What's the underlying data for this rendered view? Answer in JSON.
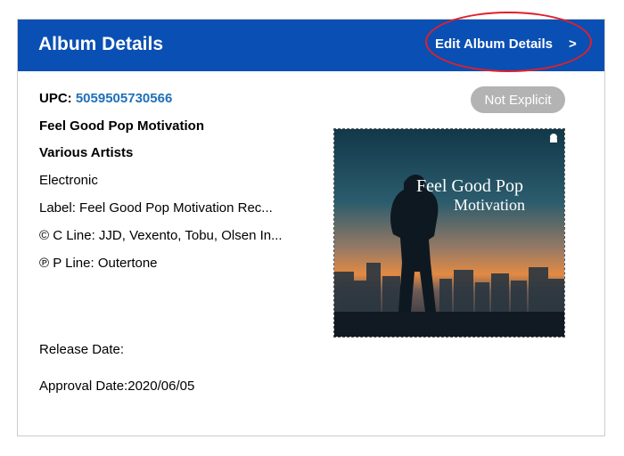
{
  "header": {
    "title": "Album Details",
    "edit_label": "Edit Album Details",
    "edit_chevron": ">"
  },
  "album": {
    "upc_label": "UPC:",
    "upc_value": "5059505730566",
    "title": "Feel Good Pop Motivation",
    "artist": "Various Artists",
    "genre": "Electronic",
    "label_line": "Label: Feel Good Pop Motivation Rec...",
    "c_line": "© C Line: JJD, Vexento, Tobu, Olsen In...",
    "p_line": "℗ P Line: Outertone",
    "release_date": "Release Date:",
    "approval_date": "Approval Date:2020/06/05",
    "explicit_badge": "Not Explicit"
  },
  "cover": {
    "title_line1": "Feel Good Pop",
    "title_line2": "Motivation"
  },
  "colors": {
    "header_bg": "#0a4fb3",
    "link": "#1f6fb8",
    "badge_bg": "#b3b3b3",
    "highlight": "#e0202a"
  }
}
